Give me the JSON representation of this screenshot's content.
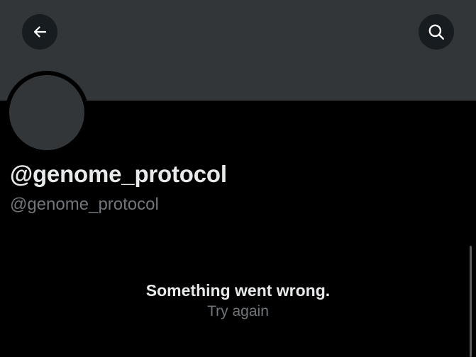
{
  "header": {
    "back_icon": "arrow-left-icon",
    "search_icon": "search-icon",
    "banner_color": "#333639"
  },
  "profile": {
    "display_name": "@genome_protocol",
    "handle": "@genome_protocol",
    "avatar_color": "#333639"
  },
  "error": {
    "title": "Something went wrong.",
    "retry_label": "Try again"
  },
  "colors": {
    "background": "#000000",
    "primary_text": "#e7e9ea",
    "secondary_text": "#71767b"
  }
}
